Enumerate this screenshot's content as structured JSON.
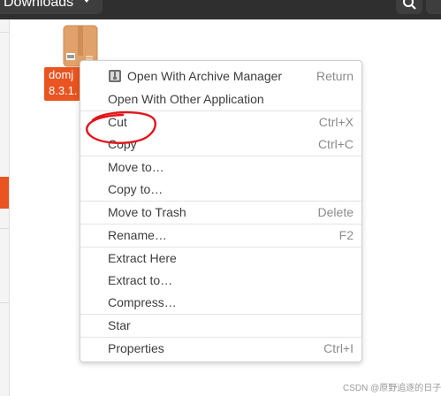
{
  "header": {
    "path_label": "Downloads"
  },
  "file": {
    "name_line1": "domj",
    "name_line2": "8.3.1."
  },
  "context_menu": {
    "items": [
      {
        "label": "Open With Archive Manager",
        "shortcut": "Return",
        "icon": "archive-manager-icon"
      },
      {
        "label": "Open With Other Application",
        "shortcut": ""
      },
      {
        "label": "Cut",
        "shortcut": "Ctrl+X"
      },
      {
        "label": "Copy",
        "shortcut": "Ctrl+C"
      },
      {
        "label": "Move to…",
        "shortcut": ""
      },
      {
        "label": "Copy to…",
        "shortcut": ""
      },
      {
        "label": "Move to Trash",
        "shortcut": "Delete"
      },
      {
        "label": "Rename…",
        "shortcut": "F2"
      },
      {
        "label": "Extract Here",
        "shortcut": ""
      },
      {
        "label": "Extract to…",
        "shortcut": ""
      },
      {
        "label": "Compress…",
        "shortcut": ""
      },
      {
        "label": "Star",
        "shortcut": ""
      },
      {
        "label": "Properties",
        "shortcut": "Ctrl+I"
      }
    ]
  },
  "watermark": "CSDN @原野追逐的日子",
  "colors": {
    "accent": "#e95420",
    "annotation": "#e0161b",
    "header_bg": "#2f2f2f"
  }
}
